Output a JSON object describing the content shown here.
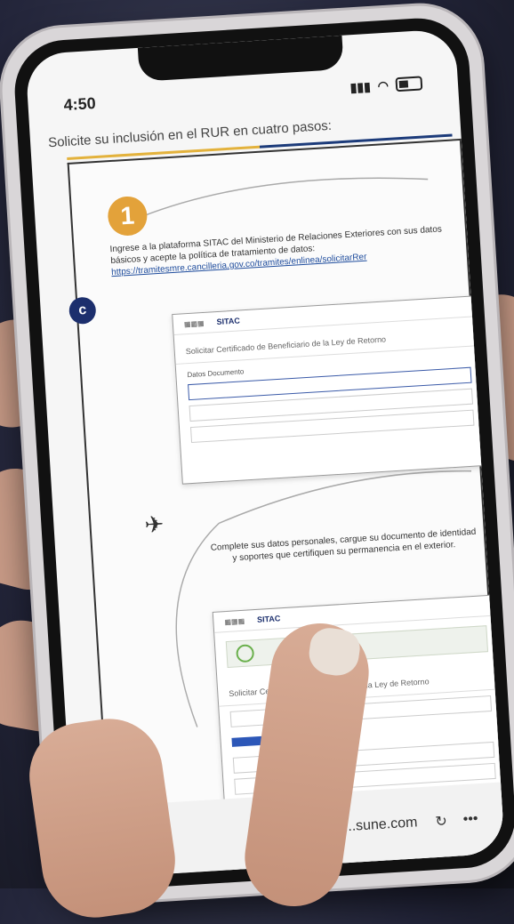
{
  "status_bar": {
    "time": "4:50"
  },
  "page": {
    "headline": "Solicite su inclusión en el RUR en cuatro pasos:",
    "step1": {
      "number": "1",
      "text": "Ingrese a la plataforma SITAC del Ministerio de Relaciones Exteriores con sus datos básicos y acepte la política de tratamiento de datos:",
      "link": "https://tramitesmre.cancilleria.gov.co/tramites/enlinea/solicitarRer"
    },
    "mock1": {
      "brand": "SITAC",
      "title": "Solicitar Certificado de Beneficiario de la Ley de Retorno",
      "section": "Datos Documento"
    },
    "step2": {
      "text": "Complete sus datos personales, cargue su documento de identidad y soportes que certifiquen su permanencia en el exterior."
    },
    "mock2": {
      "brand": "SITAC",
      "title": "Solicitar Certificado de Beneficiario de la Ley de Retorno"
    }
  },
  "browser": {
    "url": "...sune.com"
  }
}
